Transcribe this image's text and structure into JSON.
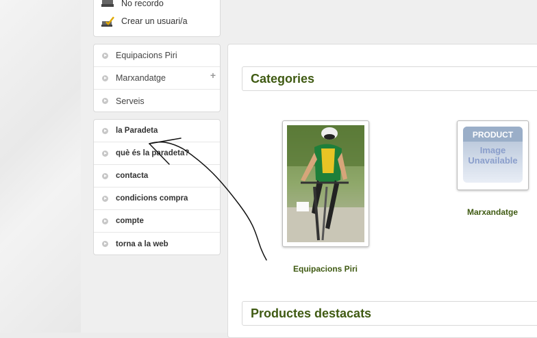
{
  "login": {
    "forgot_label": "No recordo",
    "create_label": "Crear un usuari/a"
  },
  "menu_primary": [
    {
      "label": "Equipacions Piri",
      "has_plus": false
    },
    {
      "label": "Marxandatge",
      "has_plus": true
    },
    {
      "label": "Serveis",
      "has_plus": false
    }
  ],
  "menu_secondary": [
    {
      "label": "la Paradeta"
    },
    {
      "label": "què és la paradeta?"
    },
    {
      "label": "contacta"
    },
    {
      "label": "condicions compra"
    },
    {
      "label": "compte"
    },
    {
      "label": "torna a la web"
    }
  ],
  "main": {
    "categories_title": "Categories",
    "featured_title": "Productes destacats",
    "categories": [
      {
        "label": "Equipacions Piri",
        "image": "cyclist-photo"
      },
      {
        "label": "Marxandatge",
        "image": "product-image-unavailable"
      }
    ],
    "placeholder_image": {
      "line1": "PRODUCT",
      "line2": "Image",
      "line3": "Unavailable"
    }
  },
  "colors": {
    "heading_green": "#3f5a12",
    "annotation_stroke": "#111111"
  }
}
